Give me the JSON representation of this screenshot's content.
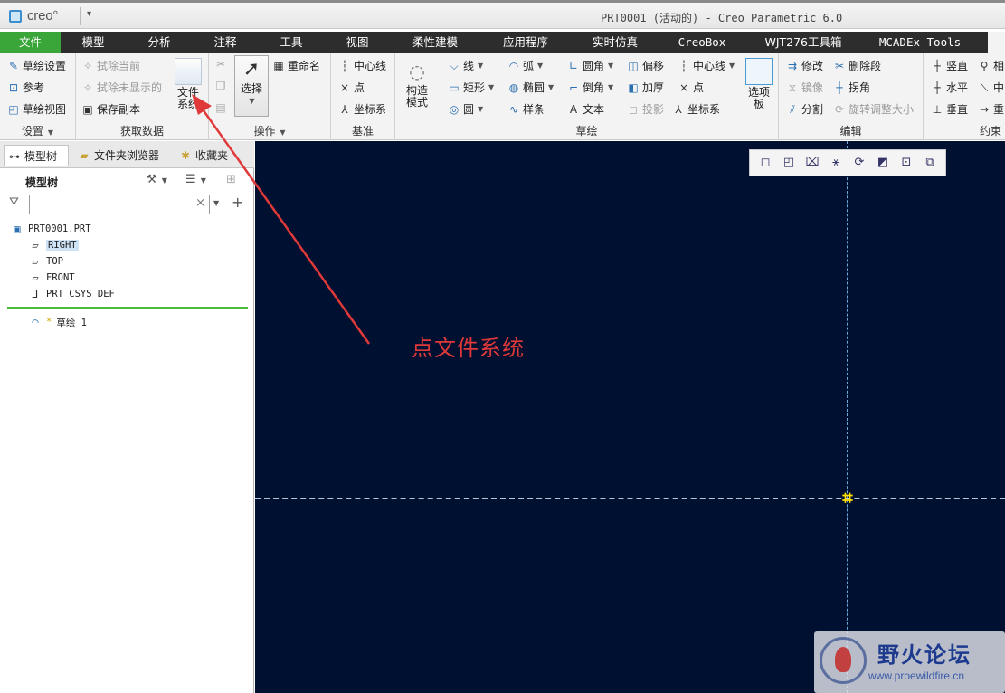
{
  "app": {
    "logo_text": "creo°",
    "window_title": "PRT0001 (活动的) - Creo Parametric 6.0",
    "qa_dropdown": "▾"
  },
  "menubar": {
    "items": [
      "文件",
      "模型",
      "分析",
      "注释",
      "工具",
      "视图",
      "柔性建模",
      "应用程序",
      "实时仿真",
      "CreoBox",
      "WJT276工具箱",
      "MCADEx Tools",
      "草绘"
    ],
    "active_color": "#3aa63a"
  },
  "ribbon": {
    "settings": {
      "items": [
        "草绘设置",
        "参考",
        "草绘视图"
      ],
      "label": "设置"
    },
    "getdata": {
      "items": [
        "拭除当前",
        "拭除未显示的",
        "保存副本"
      ],
      "big_button": "文件系统",
      "big_line1": "文件",
      "big_line2": "系统",
      "label": "获取数据"
    },
    "operations": {
      "select_label": "选择",
      "rename_label": "重命名",
      "label": "操作"
    },
    "datum": {
      "items": [
        "中心线",
        "点",
        "坐标系"
      ],
      "label": "基准"
    },
    "sketch": {
      "construction_mode": "构造模式",
      "construction_line1": "构造",
      "construction_line2": "模式",
      "col1": [
        "线",
        "矩形",
        "圆"
      ],
      "col2": [
        "弧",
        "椭圆",
        "样条"
      ],
      "col3": [
        "圆角",
        "倒角",
        "文本"
      ],
      "col4": [
        "偏移",
        "加厚",
        "投影"
      ],
      "col5": [
        "中心线",
        "点",
        "坐标系"
      ],
      "palette": "选项板",
      "palette_line1": "选项",
      "palette_line2": "板",
      "label": "草绘"
    },
    "edit": {
      "col1": [
        "修改",
        "镜像",
        "分割"
      ],
      "col2": [
        "删除段",
        "拐角",
        "旋转调整大小"
      ],
      "label": "编辑"
    },
    "constraint": {
      "col1": [
        "竖直",
        "水平",
        "垂直"
      ],
      "col2": [
        "相",
        "中",
        "重"
      ],
      "label": "约束"
    }
  },
  "leftpanel": {
    "tabs": [
      "模型树",
      "文件夹浏览器",
      "收藏夹"
    ],
    "tree_title": "模型树",
    "search": {
      "value": "",
      "placeholder": ""
    },
    "tree": [
      "PRT0001.PRT",
      "RIGHT",
      "TOP",
      "FRONT",
      "PRT_CSYS_DEF"
    ],
    "sketch_item": "草绘 1"
  },
  "canvas": {
    "background": "#001030",
    "origin_color": "#ffe100"
  },
  "annotation": {
    "text": "点文件系统",
    "color": "#e0393a"
  },
  "watermark": {
    "title": "野火论坛",
    "url": "www.proewildfire.cn"
  }
}
